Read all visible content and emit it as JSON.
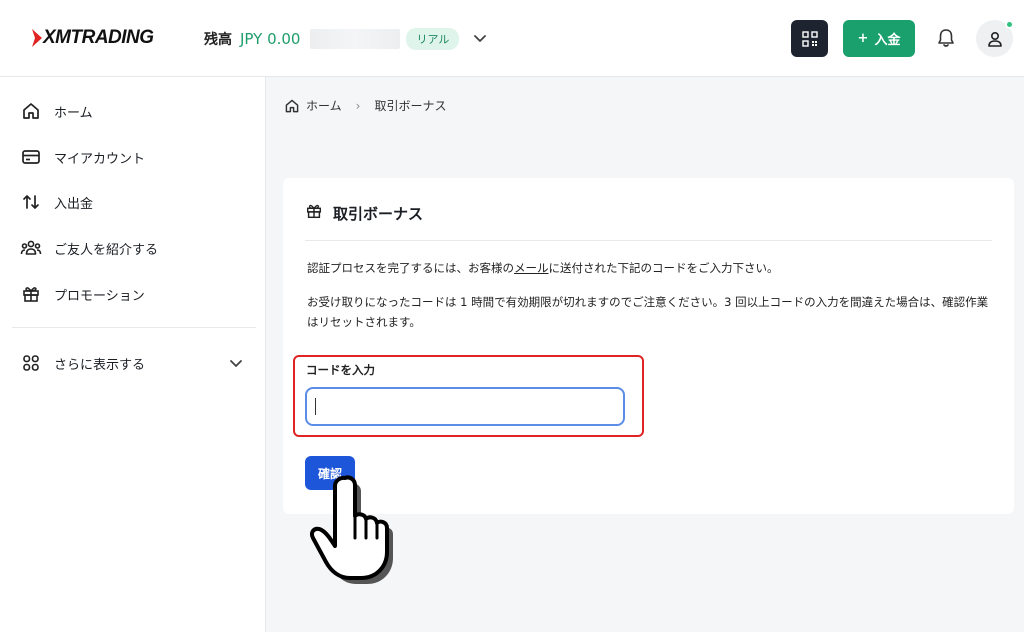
{
  "header": {
    "logo_text": "XMTRADING",
    "balance_label": "残高",
    "balance_value": "JPY 0.00",
    "account_badge": "リアル",
    "deposit_label": "入金"
  },
  "sidebar": {
    "items": [
      {
        "label": "ホーム",
        "icon": "home-icon"
      },
      {
        "label": "マイアカウント",
        "icon": "card-icon"
      },
      {
        "label": "入出金",
        "icon": "transfer-icon"
      },
      {
        "label": "ご友人を紹介する",
        "icon": "people-icon"
      },
      {
        "label": "プロモーション",
        "icon": "gift-icon"
      }
    ],
    "more_label": "さらに表示する"
  },
  "breadcrumb": {
    "home": "ホーム",
    "current": "取引ボーナス"
  },
  "card": {
    "title": "取引ボーナス",
    "para1_before": "認証プロセスを完了するには、お客様の",
    "para1_link": "メール",
    "para1_after": "に送付された下記のコードをご入力下さい。",
    "para2": "お受け取りになったコードは 1 時間で有効期限が切れますのでご注意ください。3 回以上コードの入力を間違えた場合は、確認作業はリセットされます。",
    "input_label": "コードを入力",
    "input_value": "",
    "confirm_label": "確認"
  },
  "colors": {
    "brand_green": "#1aa06d",
    "confirm_blue": "#1e56d9",
    "highlight_red": "#e02424",
    "dark_button": "#1e2330"
  }
}
